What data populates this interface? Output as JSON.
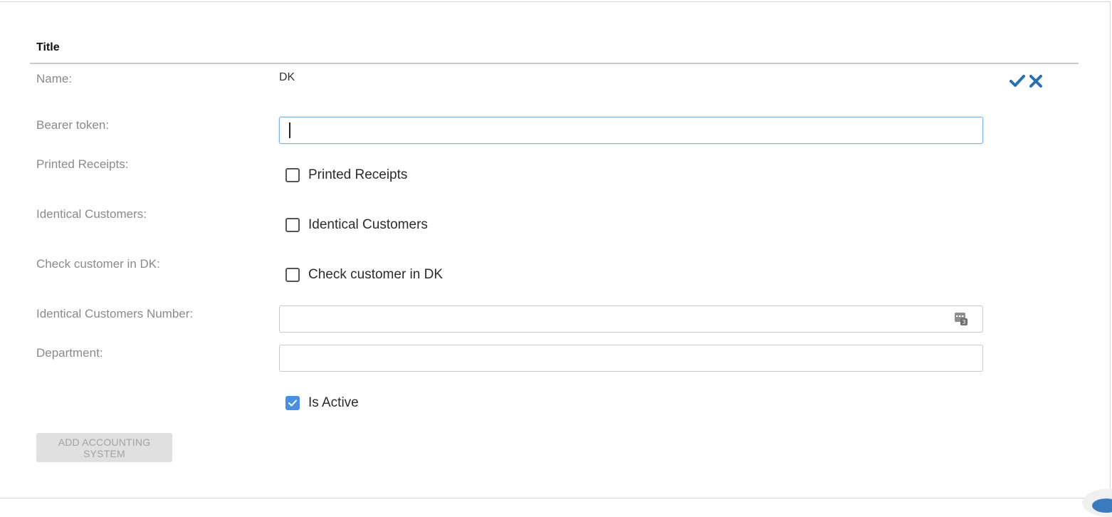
{
  "form": {
    "title": "Title",
    "name": {
      "label": "Name:",
      "value": "DK"
    },
    "bearer_token": {
      "label": "Bearer token:",
      "value": ""
    },
    "printed_receipts": {
      "label": "Printed Receipts:",
      "checkbox_label": "Printed Receipts",
      "checked": false
    },
    "identical_customers": {
      "label": "Identical Customers:",
      "checkbox_label": "Identical Customers",
      "checked": false
    },
    "check_customer": {
      "label": "Check customer in DK:",
      "checkbox_label": "Check customer in DK",
      "checked": false
    },
    "identical_customers_number": {
      "label": "Identical Customers Number:",
      "value": ""
    },
    "department": {
      "label": "Department:",
      "value": ""
    },
    "is_active": {
      "checkbox_label": "Is Active",
      "checked": true
    },
    "add_button_label": "ADD ACCOUNTING SYSTEM"
  },
  "icons": {
    "confirm": "check-icon",
    "cancel": "close-icon",
    "number_picker": "calculator-icon"
  },
  "colors": {
    "accent": "#2a6fb5",
    "checkbox_checked": "#4a8fe0",
    "label": "#8a8a8a"
  }
}
